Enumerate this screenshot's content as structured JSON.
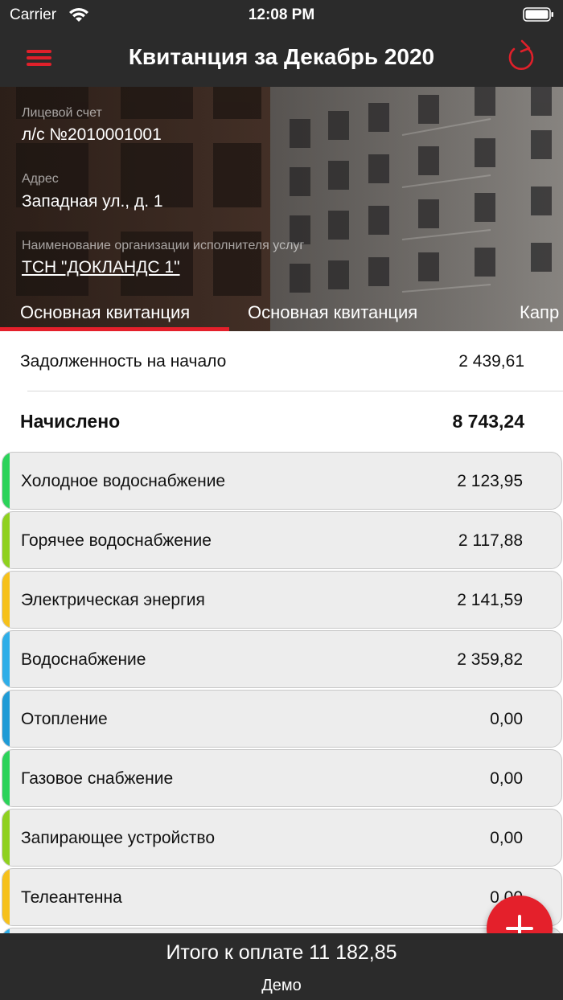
{
  "status_bar": {
    "carrier": "Carrier",
    "time": "12:08 PM"
  },
  "nav": {
    "title": "Квитанция за Декабрь 2020",
    "menu_icon": "hamburger-icon",
    "refresh_icon": "refresh-icon"
  },
  "account": {
    "account_label": "Лицевой счет",
    "account_value": "л/с №2010001001",
    "address_label": "Адрес",
    "address_value": "Западная ул., д. 1",
    "org_label": "Наименование организации исполнителя услуг",
    "org_value": "ТСН \"ДОКЛАНДС 1\""
  },
  "tabs": [
    {
      "label": "Основная квитанция",
      "active": true
    },
    {
      "label": "Основная квитанция",
      "active": false
    },
    {
      "label": "Капр",
      "active": false
    }
  ],
  "summary": {
    "debt_label": "Задолженность на начало",
    "debt_value": "2 439,61",
    "charged_label": "Начислено",
    "charged_value": "8 743,24"
  },
  "items": [
    {
      "name": "Холодное водоснабжение",
      "amount": "2 123,95",
      "color": "#2bd35a"
    },
    {
      "name": "Горячее водоснабжение",
      "amount": "2 117,88",
      "color": "#8fd11f"
    },
    {
      "name": "Электрическая энергия",
      "amount": "2 141,59",
      "color": "#f6c11a"
    },
    {
      "name": "Водоснабжение",
      "amount": "2 359,82",
      "color": "#2eaee8"
    },
    {
      "name": "Отопление",
      "amount": "0,00",
      "color": "#1e9bd6"
    },
    {
      "name": "Газовое снабжение",
      "amount": "0,00",
      "color": "#2bd35a"
    },
    {
      "name": "Запирающее устройство",
      "amount": "0,00",
      "color": "#8fd11f"
    },
    {
      "name": "Телеантенна",
      "amount": "0,00",
      "color": "#f6c11a"
    },
    {
      "name": "",
      "amount": "",
      "color": "#2eaee8"
    }
  ],
  "footer": {
    "total": "Итого к оплате 11 182,85",
    "demo": "Демо"
  },
  "colors": {
    "accent": "#e4202b",
    "bar": "#2b2b2b"
  }
}
